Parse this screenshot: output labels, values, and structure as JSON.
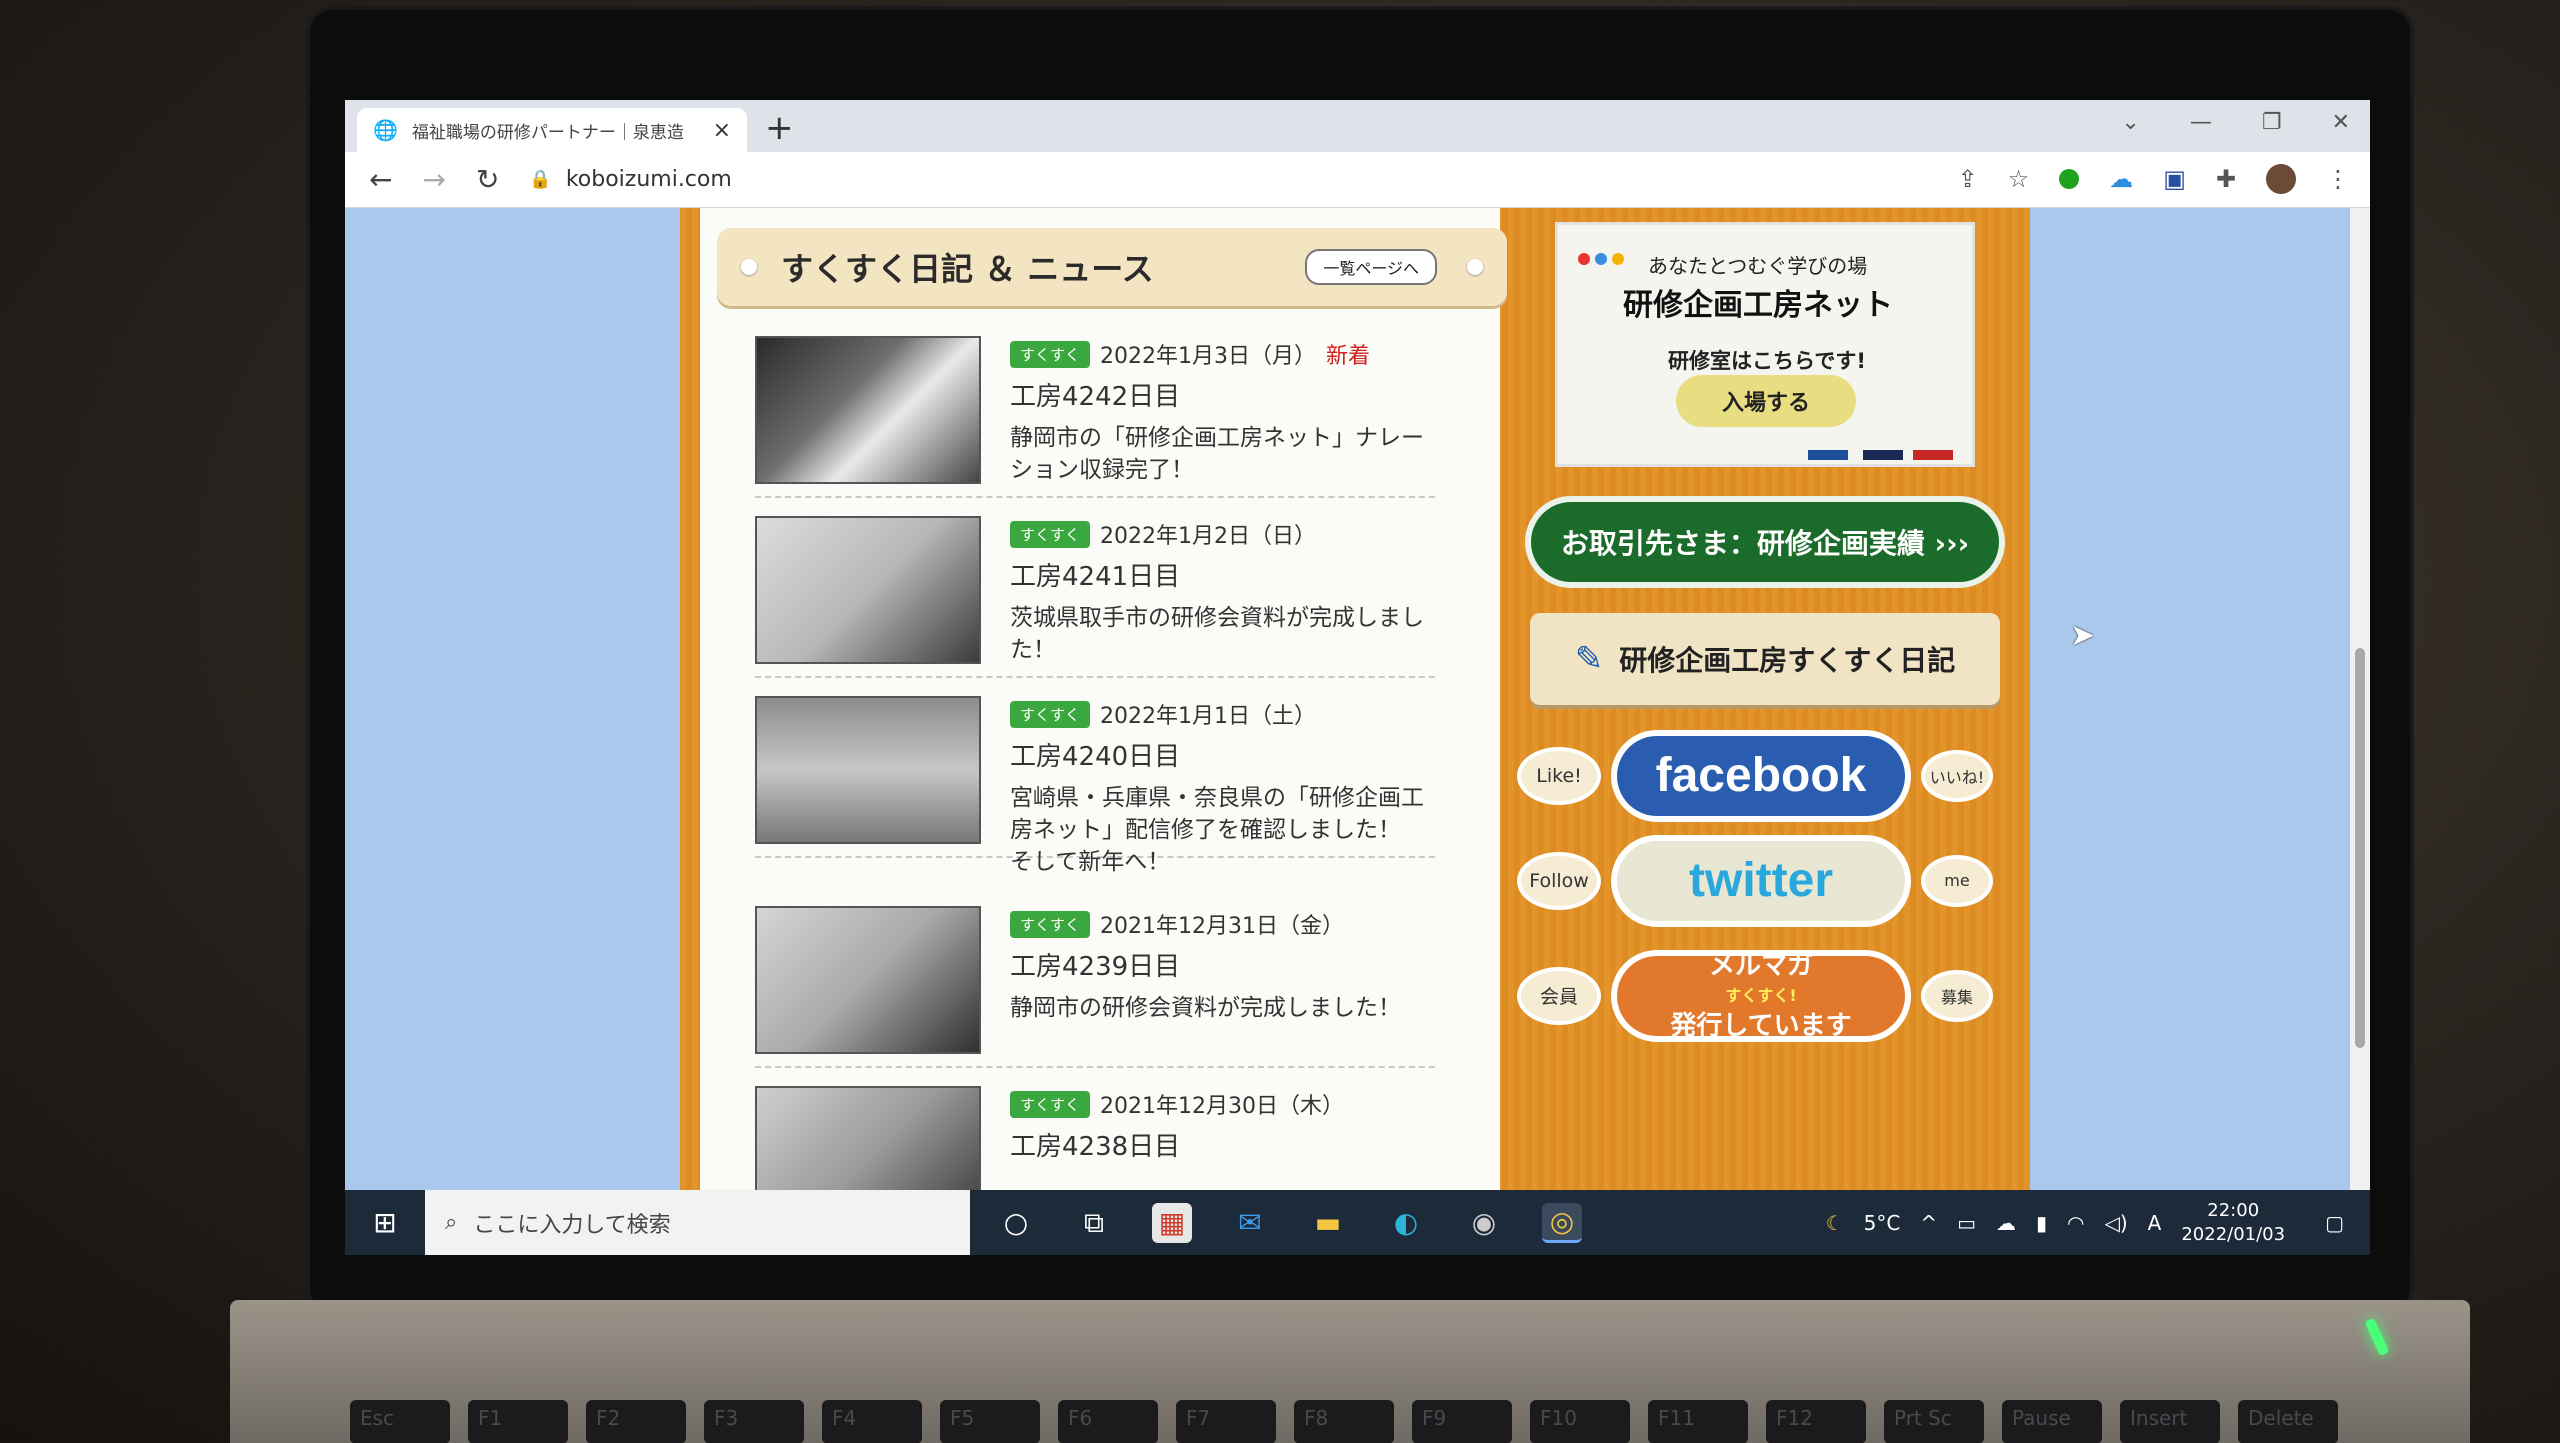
{
  "browser": {
    "tab_title": "福祉職場の研修パートナー｜泉恵造",
    "tab_close": "×",
    "new_tab": "+",
    "url": "koboizumi.com",
    "nav_back": "←",
    "nav_forward": "→",
    "nav_reload": "↻"
  },
  "news": {
    "title": "すくすく日記 ＆ ニュース",
    "more_label": "一覧ページへ",
    "items": [
      {
        "tag": "すくすく",
        "date": "2022年1月3日（月）",
        "badge": "新着",
        "day": "工房4242日目",
        "text": "静岡市の「研修企画工房ネット」ナレーション収録完了！"
      },
      {
        "tag": "すくすく",
        "date": "2022年1月2日（日）",
        "badge": "",
        "day": "工房4241日目",
        "text": "茨城県取手市の研修会資料が完成しました！"
      },
      {
        "tag": "すくすく",
        "date": "2022年1月1日（土）",
        "badge": "",
        "day": "工房4240日目",
        "text": "宮崎県・兵庫県・奈良県の「研修企画工房ネット」配信修了を確認しました！　そして新年へ！"
      },
      {
        "tag": "すくすく",
        "date": "2021年12月31日（金）",
        "badge": "",
        "day": "工房4239日目",
        "text": "静岡市の研修会資料が完成しました！"
      },
      {
        "tag": "すくすく",
        "date": "2021年12月30日（木）",
        "badge": "",
        "day": "工房4238日目",
        "text": ""
      }
    ]
  },
  "sidebar": {
    "promo_sub": "あなたとつむぐ学びの場",
    "promo_title": "研修企画工房ネット",
    "promo_room": "研修室はこちらです!",
    "enter_label": "入場する",
    "clients_label": "お取引先さま：研修企画実績 ›››",
    "diary_label": "研修企画工房すくすく日記",
    "fb_left": "Like!",
    "fb_brand": "facebook",
    "fb_right": "いいね!",
    "tw_left": "Follow",
    "tw_brand": "twitter",
    "tw_right": "me",
    "mm_left": "会員",
    "mm_line1": "メルマガ",
    "mm_tag": "すくすく!",
    "mm_line2": "発行しています",
    "mm_right": "募集"
  },
  "taskbar": {
    "search_placeholder": "ここに入力して検索",
    "weather": "5°C",
    "ime": "A",
    "time": "22:00",
    "date": "2022/01/03"
  },
  "keyboard": [
    "Esc",
    "F1",
    "F2",
    "F3",
    "F4",
    "F5",
    "F6",
    "F7",
    "F8",
    "F9",
    "F10",
    "F11",
    "F12",
    "Prt Sc",
    "Pause",
    "Insert",
    "Delete"
  ]
}
